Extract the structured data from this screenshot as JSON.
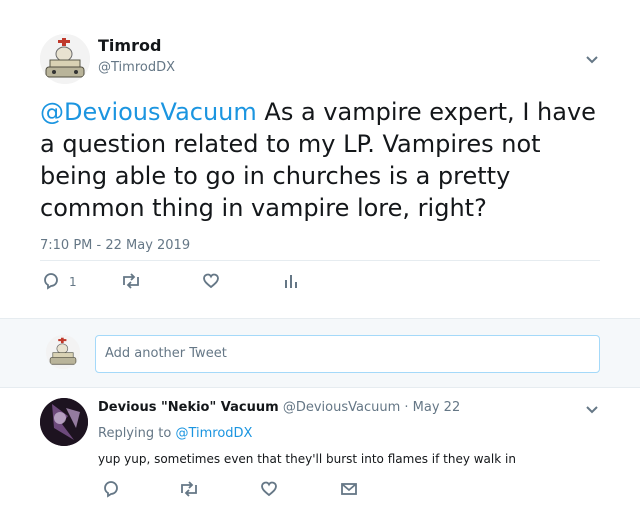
{
  "tweet": {
    "display_name": "Timrod",
    "handle": "@TimrodDX",
    "mention": "@DeviousVacuum",
    "text": "As a vampire expert, I have a question related to my LP. Vampires not being able to go in churches is a pretty common thing in vampire lore, right?",
    "timestamp": "7:10 PM - 22 May 2019",
    "reply_count": "1",
    "icons": [
      "reply-icon",
      "retweet-icon",
      "like-icon",
      "analytics-icon",
      "chevron-down-icon"
    ]
  },
  "compose": {
    "placeholder": "Add another Tweet"
  },
  "reply": {
    "display_name": "Devious \"Nekio\" Vacuum",
    "handle": "@DeviousVacuum",
    "separator": "·",
    "date": "May 22",
    "replying_label": "Replying to",
    "replying_to": "@TimrodDX",
    "text": "yup yup, sometimes even that they'll burst into flames if they walk in",
    "icons": [
      "reply-icon",
      "retweet-icon",
      "like-icon",
      "message-icon",
      "chevron-down-icon"
    ]
  },
  "colors": {
    "link": "#1b95e0",
    "muted": "#657786",
    "compose_bg": "#f5f8fa",
    "divider": "#e6ecf0"
  }
}
